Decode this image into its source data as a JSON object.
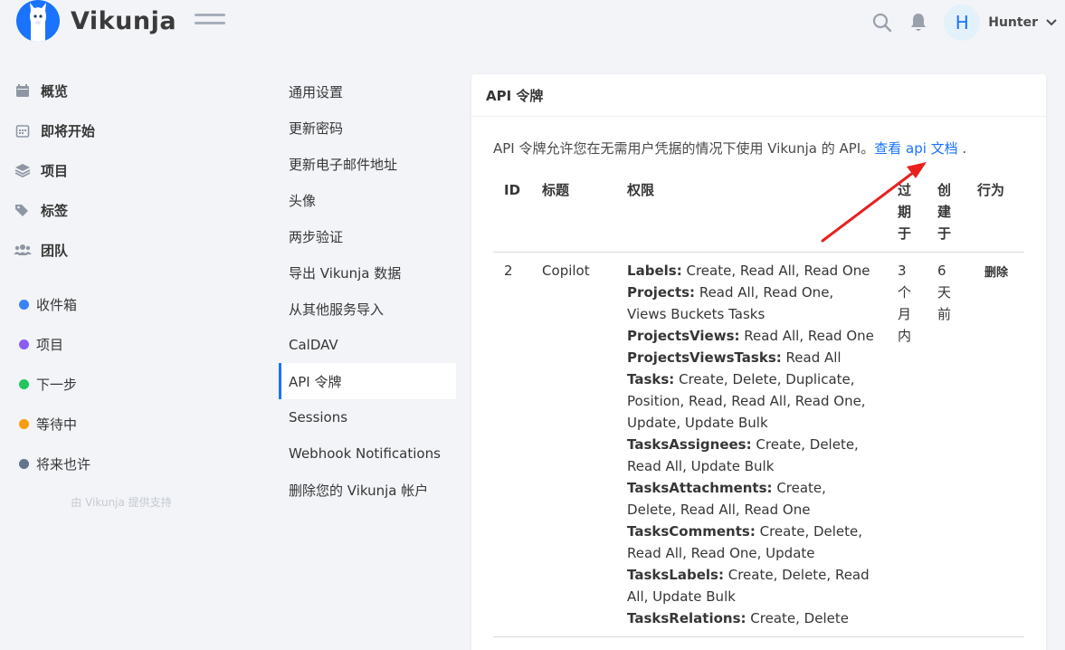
{
  "app": {
    "name": "Vikunja",
    "user_initial": "H",
    "username": "Hunter"
  },
  "nav": {
    "main": [
      {
        "label": "概览",
        "icon": "calendar-icon"
      },
      {
        "label": "即将开始",
        "icon": "calendar-week-icon"
      },
      {
        "label": "项目",
        "icon": "layers-icon"
      },
      {
        "label": "标签",
        "icon": "tags-icon"
      },
      {
        "label": "团队",
        "icon": "users-icon"
      }
    ],
    "projects": [
      {
        "label": "收件箱",
        "color": "#3b82f6"
      },
      {
        "label": "项目",
        "color": "#8b5cf6"
      },
      {
        "label": "下一步",
        "color": "#22c55e"
      },
      {
        "label": "等待中",
        "color": "#f59e0b"
      },
      {
        "label": "将来也许",
        "color": "#64748b"
      }
    ],
    "powered_by": "由 Vikunja 提供支持"
  },
  "settings_menu": [
    "通用设置",
    "更新密码",
    "更新电子邮件地址",
    "头像",
    "两步验证",
    "导出 Vikunja 数据",
    "从其他服务导入",
    "CalDAV",
    "API 令牌",
    "Sessions",
    "Webhook Notifications",
    "删除您的 Vikunja 帐户"
  ],
  "card": {
    "title": "API 令牌",
    "intro_text": "API 令牌允许您在无需用户凭据的情况下使用 Vikunja 的 API。",
    "docs_link": "查看 api 文档",
    "docs_suffix": " .",
    "headers": {
      "id": "ID",
      "title": "标题",
      "permissions": "权限",
      "expires": "过期于",
      "created": "创建于",
      "actions": "行为"
    },
    "rows": [
      {
        "id": "2",
        "title": "Copilot",
        "permissions": [
          {
            "group": "Labels:",
            "rights": "Create, Read All, Read One"
          },
          {
            "group": "Projects:",
            "rights": "Read All, Read One, Views Buckets Tasks"
          },
          {
            "group": "ProjectsViews:",
            "rights": "Read All, Read One"
          },
          {
            "group": "ProjectsViewsTasks:",
            "rights": "Read All"
          },
          {
            "group": "Tasks:",
            "rights": "Create, Delete, Duplicate, Position, Read, Read All, Read One, Update, Update Bulk"
          },
          {
            "group": "TasksAssignees:",
            "rights": "Create, Delete, Read All, Update Bulk"
          },
          {
            "group": "TasksAttachments:",
            "rights": "Create, Delete, Read All, Read One"
          },
          {
            "group": "TasksComments:",
            "rights": "Create, Delete, Read All, Read One, Update"
          },
          {
            "group": "TasksLabels:",
            "rights": "Create, Delete, Read All, Update Bulk"
          },
          {
            "group": "TasksRelations:",
            "rights": "Create, Delete"
          }
        ],
        "expires": "3个月内",
        "created": "6天前",
        "action": "删除"
      }
    ]
  },
  "colors": {
    "accent": "#1973ff",
    "annotation_arrow": "#e8211f"
  }
}
